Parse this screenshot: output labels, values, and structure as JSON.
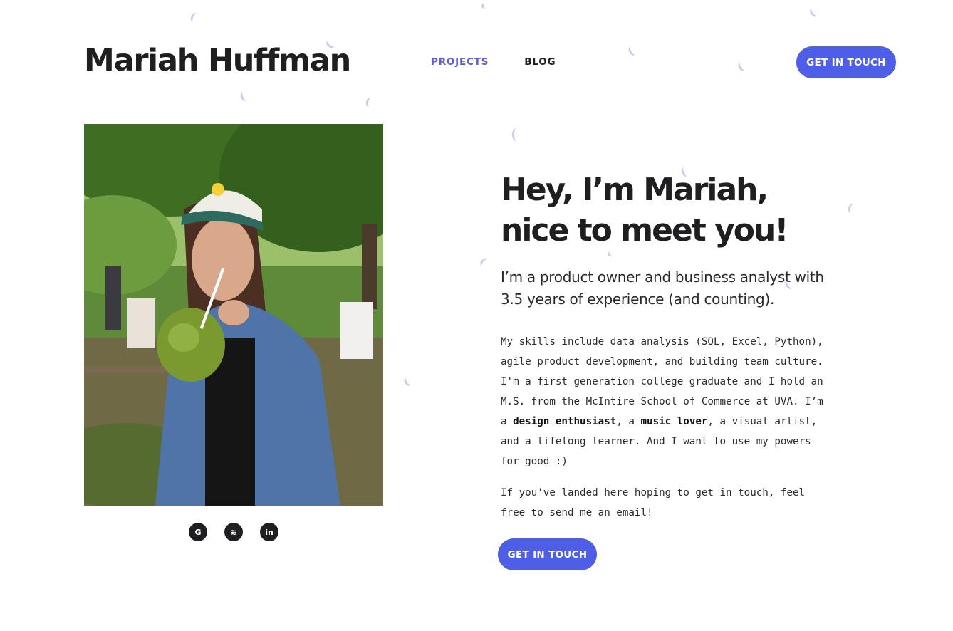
{
  "header": {
    "brand": "Mariah Huffman",
    "nav": [
      {
        "label": "PROJECTS",
        "active": true
      },
      {
        "label": "BLOG",
        "active": false
      }
    ],
    "cta_label": "GET IN TOUCH"
  },
  "photo": {
    "alt": "Photo of Mariah drinking from a coconut in a park"
  },
  "socials": [
    {
      "name": "github",
      "icon": "github-icon",
      "glyph": "G"
    },
    {
      "name": "spotify",
      "icon": "spotify-icon",
      "glyph": "≋"
    },
    {
      "name": "linkedin",
      "icon": "linkedin-icon",
      "glyph": "in"
    }
  ],
  "intro": {
    "headline": "Hey, I’m Mariah, nice to meet you!",
    "tagline": "I’m a product owner and business analyst with 3.5 years of experience (and counting).",
    "bio_part1": "My skills include data analysis (SQL, Excel, Python), agile product development, and building team culture. I'm a first generation college graduate and I hold an M.S. from the McIntire School of Commerce at UVA. I’m a ",
    "bio_bold1": "design enthusiast",
    "bio_part2": ", a ",
    "bio_bold2": "music lover",
    "bio_part3": ", a visual artist, and a lifelong learner. And I want to use my powers for good :)",
    "contact_note": "If you've landed here hoping to get in touch, feel free to send me an email!",
    "cta_label": "GET IN TOUCH"
  },
  "colors": {
    "accent": "#4f5ee6",
    "nav_active": "#5a5fd9",
    "text": "#1f1f21",
    "confetti": "#c7cbf3"
  }
}
